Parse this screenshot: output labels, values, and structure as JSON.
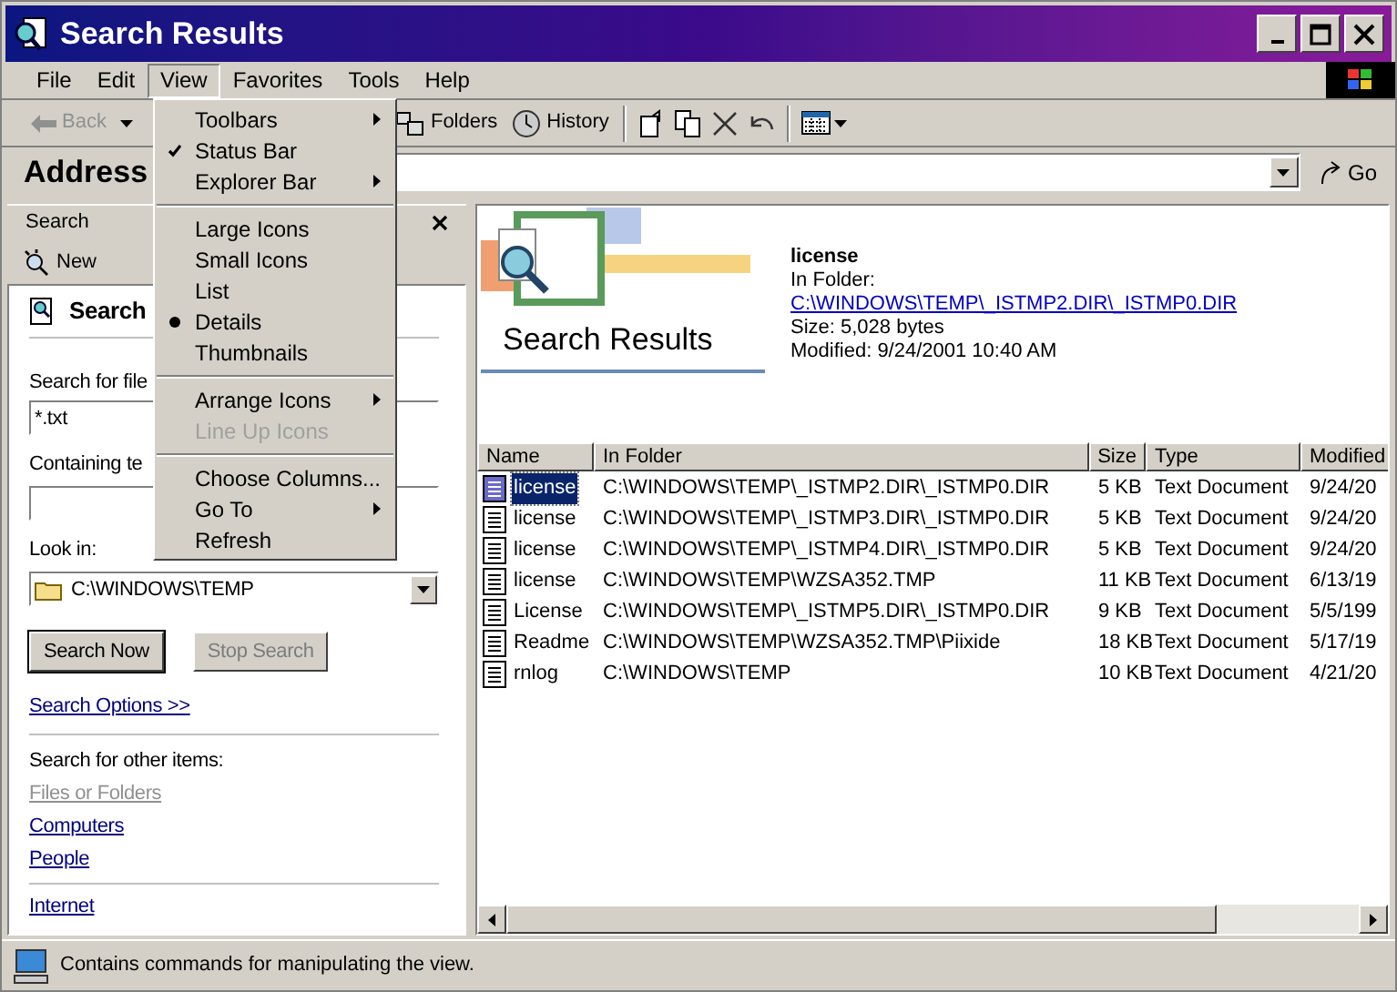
{
  "window": {
    "title": "Search Results"
  },
  "menu_bar": [
    {
      "label": "File",
      "selected": false
    },
    {
      "label": "Edit",
      "selected": false
    },
    {
      "label": "View",
      "selected": true
    },
    {
      "label": "Favorites",
      "selected": false
    },
    {
      "label": "Tools",
      "selected": false
    },
    {
      "label": "Help",
      "selected": false
    }
  ],
  "toolbar": {
    "back": {
      "label": "Back",
      "disabled": true
    },
    "folders": "Folders",
    "history": "History"
  },
  "address_bar": {
    "label": "Address",
    "go": "Go"
  },
  "view_menu": [
    {
      "kind": "check",
      "label": "Toolbars",
      "checked": false,
      "submenu": true,
      "disabled": false
    },
    {
      "kind": "check",
      "label": "Status Bar",
      "checked": true,
      "submenu": false,
      "disabled": false
    },
    {
      "kind": "check",
      "label": "Explorer Bar",
      "checked": false,
      "submenu": true,
      "disabled": false
    },
    {
      "kind": "separator"
    },
    {
      "kind": "radio",
      "label": "Large Icons",
      "checked": false,
      "submenu": false,
      "disabled": false
    },
    {
      "kind": "radio",
      "label": "Small Icons",
      "checked": false,
      "submenu": false,
      "disabled": false
    },
    {
      "kind": "radio",
      "label": "List",
      "checked": false,
      "submenu": false,
      "disabled": false
    },
    {
      "kind": "radio",
      "label": "Details",
      "checked": true,
      "submenu": false,
      "disabled": false
    },
    {
      "kind": "radio",
      "label": "Thumbnails",
      "checked": false,
      "submenu": false,
      "disabled": false
    },
    {
      "kind": "separator"
    },
    {
      "kind": "check",
      "label": "Arrange Icons",
      "checked": false,
      "submenu": true,
      "disabled": false
    },
    {
      "kind": "check",
      "label": "Line Up Icons",
      "checked": false,
      "submenu": false,
      "disabled": true
    },
    {
      "kind": "separator"
    },
    {
      "kind": "check",
      "label": "Choose Columns...",
      "checked": false,
      "submenu": false,
      "disabled": false
    },
    {
      "kind": "check",
      "label": "Go To",
      "checked": false,
      "submenu": true,
      "disabled": false
    },
    {
      "kind": "check",
      "label": "Refresh",
      "checked": false,
      "submenu": false,
      "disabled": false
    }
  ],
  "search_pane": {
    "title": "Search",
    "new_button": "New",
    "heading": "Search",
    "file_label": "Search for file",
    "file_value": "*.txt",
    "containing_label": "Containing te",
    "look_in_label": "Look in:",
    "look_in_value": "C:\\WINDOWS\\TEMP",
    "search_now": {
      "label": "Search Now",
      "disabled": false
    },
    "stop_search": {
      "label": "Stop Search",
      "disabled": true
    },
    "options_link": "Search Options >>",
    "other_label": "Search for other items:",
    "other_links": [
      {
        "label": "Files or Folders",
        "disabled": true
      },
      {
        "label": "Computers",
        "disabled": false
      },
      {
        "label": "People",
        "disabled": false
      }
    ],
    "internet_link": "Internet"
  },
  "results": {
    "banner_title": "Search Results",
    "details": {
      "name": "license",
      "folder_label": "In Folder:",
      "folder_link": "C:\\WINDOWS\\TEMP\\_ISTMP2.DIR\\_ISTMP0.DIR",
      "size": "Size: 5,028 bytes",
      "modified": "Modified: 9/24/2001 10:40 AM"
    },
    "table": {
      "columns": [
        "Name",
        "In Folder",
        "Size",
        "Type",
        "Modified"
      ],
      "rows": [
        {
          "selected": true,
          "cells": [
            "license",
            "C:\\WINDOWS\\TEMP\\_ISTMP2.DIR\\_ISTMP0.DIR",
            "5 KB",
            "Text Document",
            "9/24/20"
          ]
        },
        {
          "selected": false,
          "cells": [
            "license",
            "C:\\WINDOWS\\TEMP\\_ISTMP3.DIR\\_ISTMP0.DIR",
            "5 KB",
            "Text Document",
            "9/24/20"
          ]
        },
        {
          "selected": false,
          "cells": [
            "license",
            "C:\\WINDOWS\\TEMP\\_ISTMP4.DIR\\_ISTMP0.DIR",
            "5 KB",
            "Text Document",
            "9/24/20"
          ]
        },
        {
          "selected": false,
          "cells": [
            "license",
            "C:\\WINDOWS\\TEMP\\WZSA352.TMP",
            "11 KB",
            "Text Document",
            "6/13/19"
          ]
        },
        {
          "selected": false,
          "cells": [
            "License",
            "C:\\WINDOWS\\TEMP\\_ISTMP5.DIR\\_ISTMP0.DIR",
            "9 KB",
            "Text Document",
            "5/5/199"
          ]
        },
        {
          "selected": false,
          "cells": [
            "Readme",
            "C:\\WINDOWS\\TEMP\\WZSA352.TMP\\Piixide",
            "18 KB",
            "Text Document",
            "5/17/19"
          ]
        },
        {
          "selected": false,
          "cells": [
            "rnlog",
            "C:\\WINDOWS\\TEMP",
            "10 KB",
            "Text Document",
            "4/21/20"
          ]
        }
      ]
    }
  },
  "status_bar": {
    "text": "Contains commands for manipulating the view."
  }
}
